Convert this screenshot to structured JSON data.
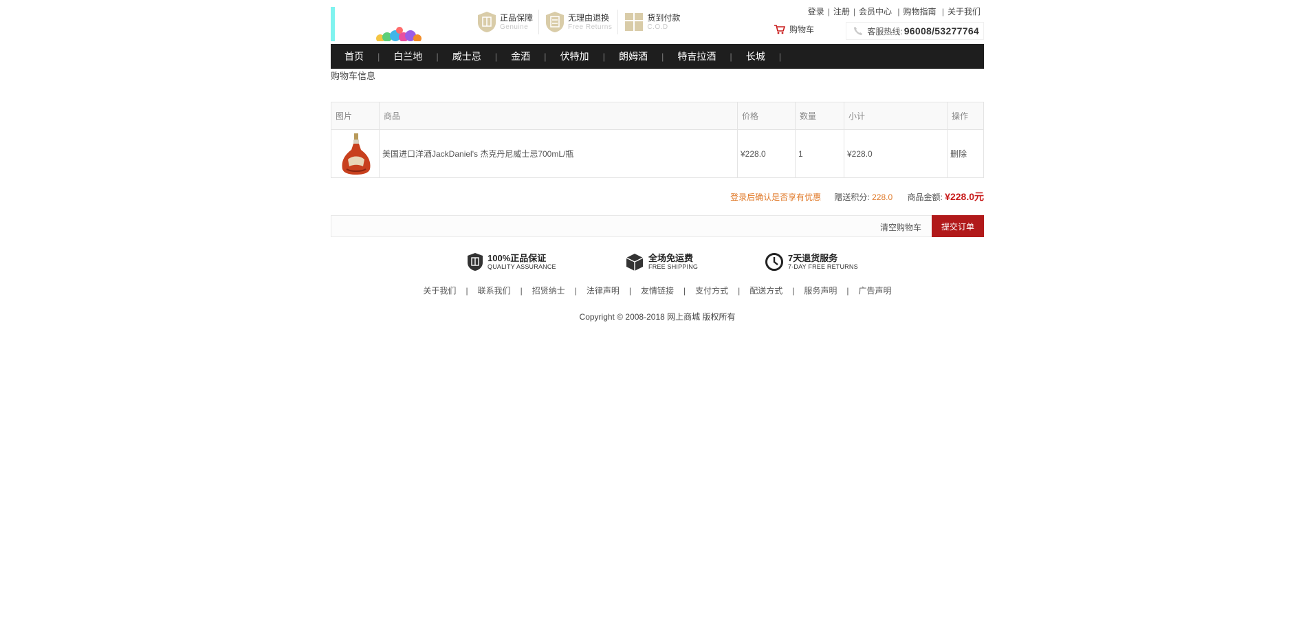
{
  "header": {
    "promises": [
      {
        "title": "正品保障",
        "subtitle": "Genuine"
      },
      {
        "title": "无理由退换",
        "subtitle": "Free Returns"
      },
      {
        "title": "货到付款",
        "subtitle": "C.O.D"
      }
    ],
    "top_links": [
      "登录",
      "注册",
      "会员中心",
      "购物指南",
      "关于我们"
    ],
    "cart_label": "购物车",
    "hotline_label": "客服热线:",
    "hotline_number": "96008/53277764"
  },
  "nav": {
    "items": [
      "首页",
      "白兰地",
      "威士忌",
      "金酒",
      "伏特加",
      "朗姆酒",
      "特吉拉酒",
      "长城"
    ]
  },
  "breadcrumb": "购物车信息",
  "cart_table": {
    "headers": [
      "图片",
      "商品",
      "价格",
      "数量",
      "小计",
      "操作"
    ],
    "rows": [
      {
        "name": "美国进口洋酒JackDaniel's 杰克丹尼威士忌700mL/瓶",
        "price": "¥228.0",
        "quantity": "1",
        "subtotal": "¥228.0",
        "action": "删除"
      }
    ]
  },
  "summary": {
    "login_hint": "登录后确认是否享有优惠",
    "points_label": "赠送积分:",
    "points_value": "228.0",
    "amount_label": "商品金额:",
    "amount_value": "¥228.0元"
  },
  "actions": {
    "clear": "清空购物车",
    "submit": "提交订单"
  },
  "guarantees": [
    {
      "title": "100%正品保证",
      "subtitle": "QUALITY ASSURANCE",
      "icon": "shield-icon"
    },
    {
      "title": "全场免运费",
      "subtitle": "FREE SHIPPING",
      "icon": "box-icon"
    },
    {
      "title": "7天退货服务",
      "subtitle": "7-DAY FREE RETURNS",
      "icon": "clock-icon"
    }
  ],
  "footer_links": [
    "关于我们",
    "联系我们",
    "招贤纳士",
    "法律声明",
    "友情链接",
    "支付方式",
    "配送方式",
    "服务声明",
    "广告声明"
  ],
  "copyright": "Copyright © 2008-2018 网上商城 版权所有",
  "colors": {
    "nav_bg": "#1e1e1e",
    "submit_bg": "#b1191a",
    "price_red": "#c81b1b",
    "hint_orange": "#e07a2a"
  }
}
